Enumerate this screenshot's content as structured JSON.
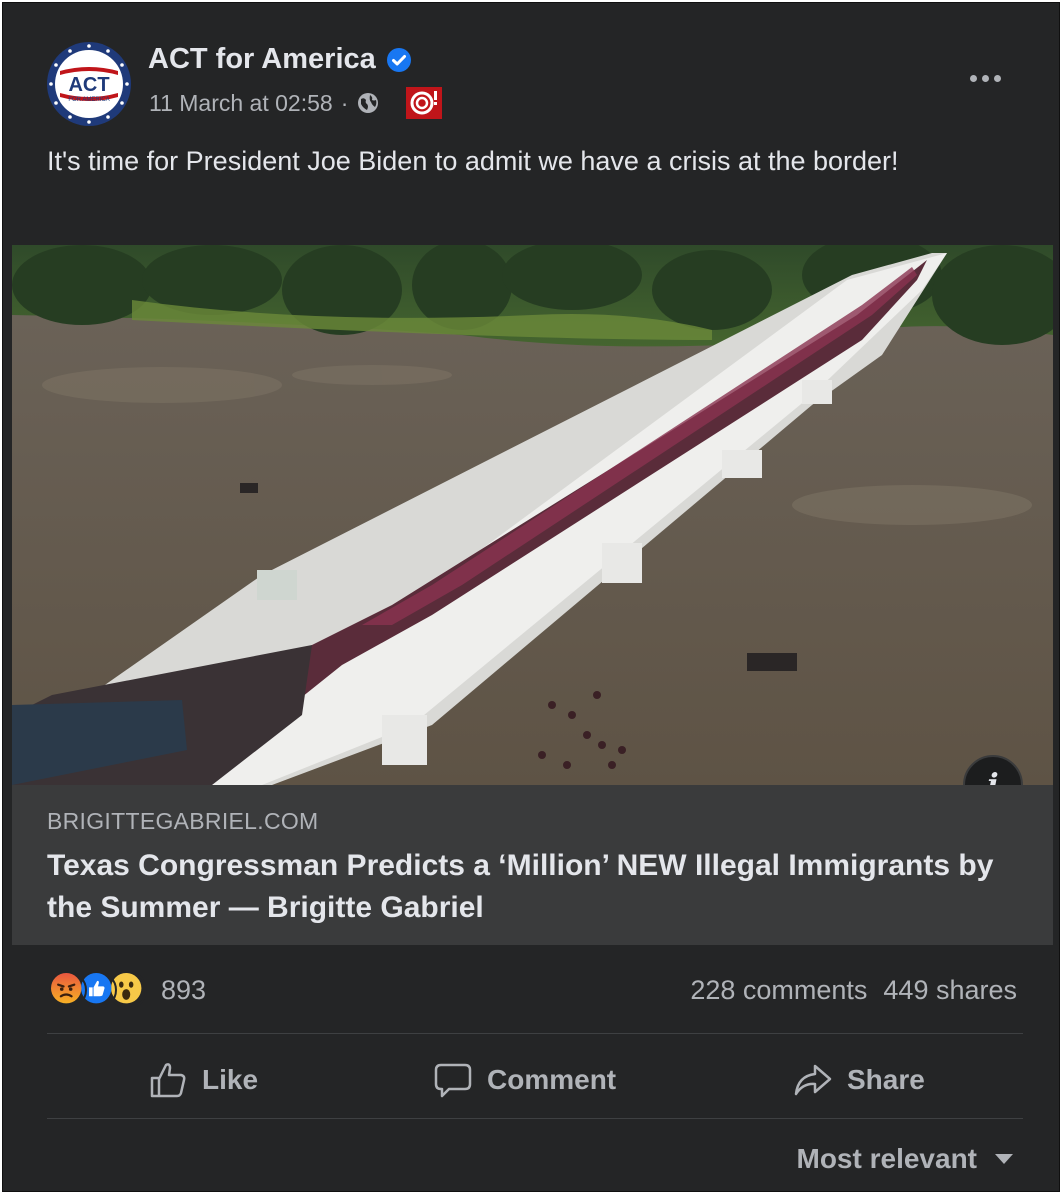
{
  "post": {
    "page_name": "ACT for America",
    "timestamp": "11 March at 02:58",
    "separator": "·",
    "text": "It's time for President Joe Biden to admit we have a crisis at the border!",
    "avatar_logo_text": "ACT",
    "avatar_logo_subtext": "FOR AMERICA"
  },
  "link": {
    "domain": "BRIGITTEGABRIEL.COM",
    "title": "Texas Congressman Predicts a ‘Million’ NEW Illegal Immigrants by the Summer — Brigitte Gabriel",
    "info_label": "i"
  },
  "engagement": {
    "reaction_icons": [
      "angry-icon",
      "like-icon",
      "wow-icon"
    ],
    "reaction_count": "893",
    "comments": "228 comments",
    "shares": "449 shares"
  },
  "actions": {
    "like": "Like",
    "comment": "Comment",
    "share": "Share"
  },
  "comments_sort": {
    "label": "Most relevant"
  },
  "colors": {
    "card_bg": "#242526",
    "link_bg": "#3a3b3c",
    "text_primary": "#e4e6eb",
    "text_secondary": "#b0b3b8",
    "verified_blue": "#1877f2",
    "badge_red": "#c0151a"
  }
}
